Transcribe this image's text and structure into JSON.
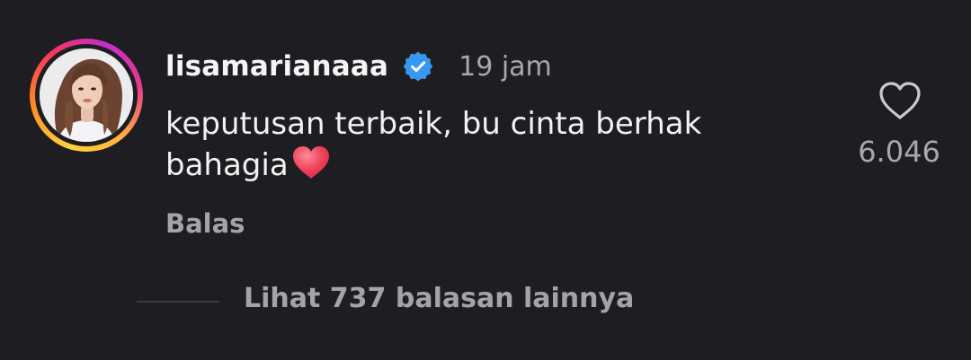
{
  "comment": {
    "username": "lisamarianaaa",
    "verified_icon": "verified-badge-icon",
    "time": "19 jam",
    "text": "keputusan terbaik, bu cinta berhak bahagia",
    "emoji": "red-heart-emoji",
    "like_icon": "heart-outline-icon",
    "likes": "6.046",
    "reply_label": "Balas",
    "view_replies_label": "Lihat 737 balasan lainnya"
  },
  "colors": {
    "background": "#1e1e22",
    "text_primary": "#f2f2f2",
    "text_secondary": "#a7a7ad",
    "verified_blue": "#3897f0",
    "emoji_red": "#f0455d"
  }
}
